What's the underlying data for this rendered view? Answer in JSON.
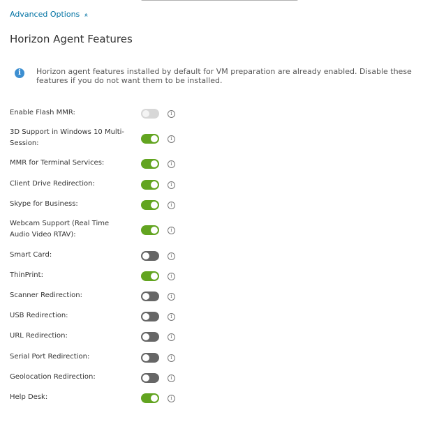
{
  "advanced_options": {
    "label": "Advanced Options",
    "chevron": "«"
  },
  "section_title": "Horizon Agent Features",
  "info_banner": {
    "icon": "info-icon",
    "glyph": "i",
    "message": "Horizon agent features installed by default for VM preparation are already enabled. Disable these features if you do not want them to be installed."
  },
  "features": [
    {
      "label": "Enable Flash MMR:",
      "state": "disabled"
    },
    {
      "label": "3D Support in Windows 10 Multi-Session:",
      "state": "on"
    },
    {
      "label": "MMR for Terminal Services:",
      "state": "on"
    },
    {
      "label": "Client Drive Redirection:",
      "state": "on"
    },
    {
      "label": "Skype for Business:",
      "state": "on"
    },
    {
      "label": "Webcam Support (Real Time Audio Video RTAV):",
      "state": "on"
    },
    {
      "label": "Smart Card:",
      "state": "off"
    },
    {
      "label": "ThinPrint:",
      "state": "on"
    },
    {
      "label": "Scanner Redirection:",
      "state": "off"
    },
    {
      "label": "USB Redirection:",
      "state": "off"
    },
    {
      "label": "URL Redirection:",
      "state": "off"
    },
    {
      "label": "Serial Port Redirection:",
      "state": "off"
    },
    {
      "label": "Geolocation Redirection:",
      "state": "off"
    },
    {
      "label": "Help Desk:",
      "state": "on"
    }
  ],
  "info_glyph": "i",
  "colors": {
    "toggle_on": "#62a420",
    "toggle_off": "#666666",
    "toggle_disabled": "#d7d7d7",
    "link": "#0072a3",
    "info_icon": "#3d8fd1"
  }
}
